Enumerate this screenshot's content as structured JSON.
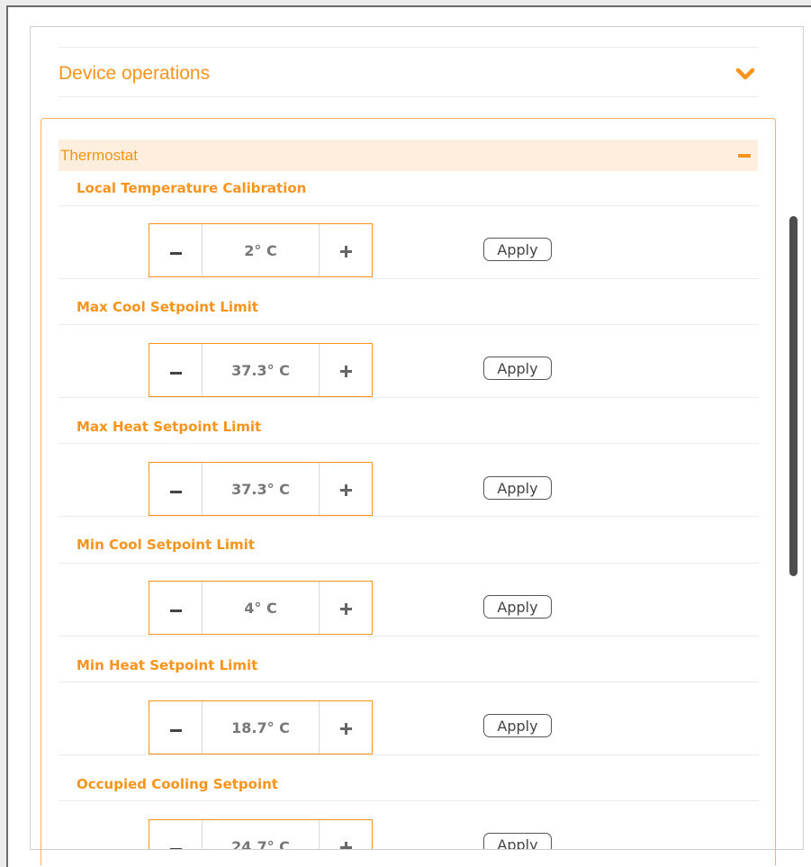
{
  "accordion": {
    "title": "Device operations"
  },
  "thermostat": {
    "title": "Thermostat",
    "settings": [
      {
        "label": "Local Temperature Calibration",
        "value": "2° C",
        "apply_label": "Apply"
      },
      {
        "label": "Max Cool Setpoint Limit",
        "value": "37.3° C",
        "apply_label": "Apply"
      },
      {
        "label": "Max Heat Setpoint Limit",
        "value": "37.3° C",
        "apply_label": "Apply"
      },
      {
        "label": "Min Cool Setpoint Limit",
        "value": "4° C",
        "apply_label": "Apply"
      },
      {
        "label": "Min Heat Setpoint Limit",
        "value": "18.7° C",
        "apply_label": "Apply"
      },
      {
        "label": "Occupied Cooling Setpoint",
        "value": "24.7° C",
        "apply_label": "Apply"
      }
    ]
  },
  "colors": {
    "accent": "#f7941d",
    "header_bg": "#fdeedd",
    "box_border": "#f7b066"
  }
}
